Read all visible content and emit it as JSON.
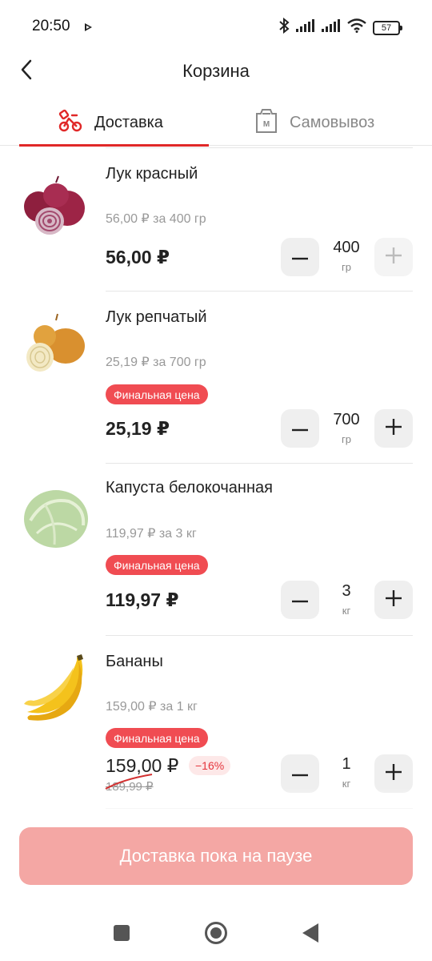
{
  "status_bar": {
    "time": "20:50",
    "battery": "57",
    "icons": [
      "play-indicator-icon",
      "bluetooth-icon",
      "signal-icon",
      "signal-icon",
      "wifi-icon",
      "battery-icon"
    ]
  },
  "header": {
    "title": "Корзина",
    "back_icon": "chevron-left-icon"
  },
  "tabs": [
    {
      "label": "Доставка",
      "icon": "scooter-icon",
      "active": true
    },
    {
      "label": "Самовывоз",
      "icon": "shopping-bag-icon",
      "active": false
    }
  ],
  "products": [
    {
      "name": "Лук красный",
      "unit_price": "56,00 ₽ за 400 гр",
      "price": "56,00 ₽",
      "quantity": "400",
      "unit": "гр",
      "plus_disabled": true,
      "image": "red-onion-image"
    },
    {
      "name": "Лук репчатый",
      "unit_price": "25,19 ₽ за 700 гр",
      "badge": "Финальная цена",
      "price": "25,19 ₽",
      "quantity": "700",
      "unit": "гр",
      "image": "yellow-onion-image"
    },
    {
      "name": "Капуста белокочанная",
      "unit_price": "119,97 ₽ за 3 кг",
      "badge": "Финальная цена",
      "price": "119,97 ₽",
      "quantity": "3",
      "unit": "кг",
      "image": "cabbage-image"
    },
    {
      "name": "Бананы",
      "unit_price": "159,00 ₽ за 1 кг",
      "badge": "Финальная цена",
      "price": "159,00 ₽",
      "old_price": "189,99 ₽",
      "discount": "−16%",
      "quantity": "1",
      "unit": "кг",
      "image": "bananas-image"
    }
  ],
  "cta": {
    "label": "Доставка пока на паузе",
    "enabled": false
  },
  "nav": {
    "icons": [
      "recent-apps-icon",
      "home-icon",
      "back-icon"
    ]
  },
  "colors": {
    "accent": "#e02828",
    "badge": "#f04c52",
    "cta_disabled": "#f4a7a4",
    "discount_bg": "#fde8e8"
  }
}
